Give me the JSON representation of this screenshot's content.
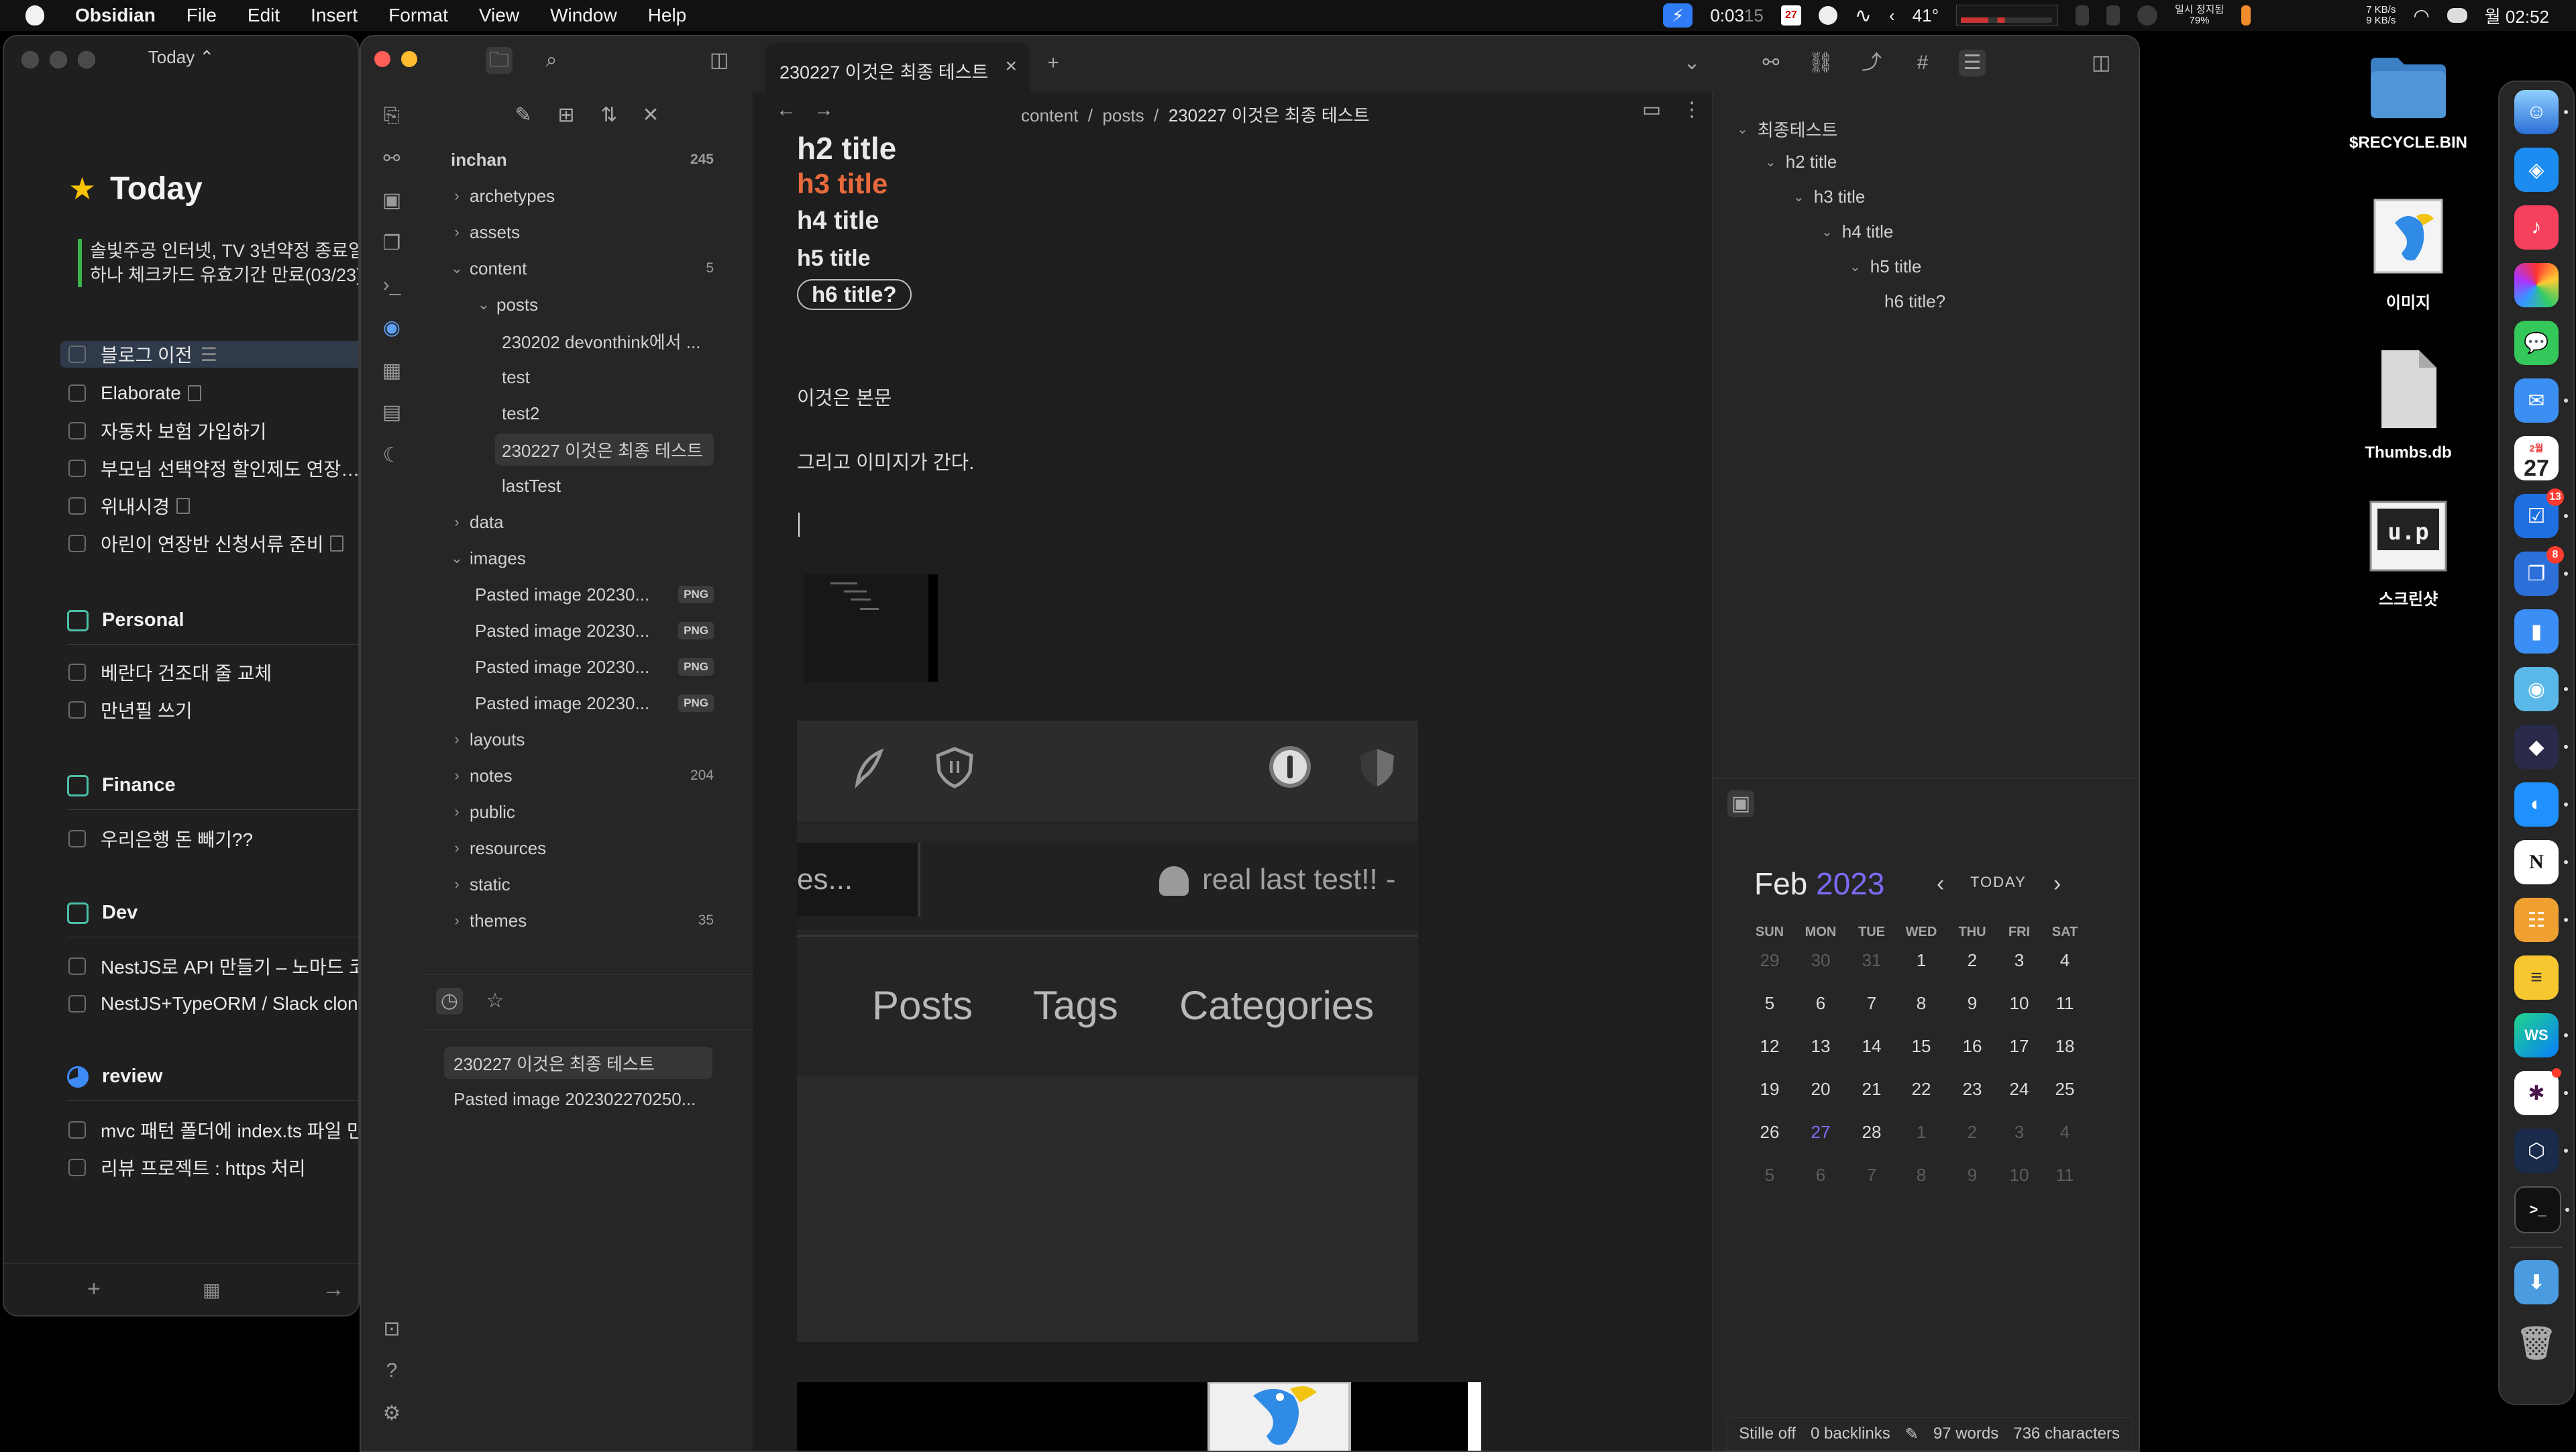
{
  "menubar": {
    "app": "Obsidian",
    "menus": [
      "File",
      "Edit",
      "Insert",
      "Format",
      "View",
      "Window",
      "Help"
    ],
    "timer": "0:03",
    "timer_seconds": "15",
    "calendar_day": "27",
    "temperature": "41°",
    "pause_label": "일시 정지됨",
    "battery_pct": "79%",
    "net_up": "7 KB/s",
    "net_down": "9 KB/s",
    "clock": "월 02:52"
  },
  "today": {
    "title": "Today",
    "heading": "Today",
    "notices": [
      "솔빛주공 인터넷, TV 3년약정 종료일",
      "하나 체크카드 유효기간 만료(03/23)"
    ],
    "tasks": [
      "블로그 이전",
      "Elaborate",
      "자동차 보험 가입하기",
      "부모님 선택약정 할인제도 연장…",
      "위내시경",
      "아린이 연장반 신청서류 준비"
    ],
    "areas": [
      {
        "name": "Personal",
        "tasks": [
          "베란다 건조대 줄 교체",
          "만년필 쓰기"
        ]
      },
      {
        "name": "Finance",
        "tasks": [
          "우리은행 돈 빼기??"
        ]
      },
      {
        "name": "Dev",
        "tasks": [
          "NestJS로 API 만들기 – 노마드 코더",
          "NestJS+TypeORM / Slack clone"
        ]
      },
      {
        "name": "review",
        "tasks": [
          "mvc 패턴 폴더에 index.ts 파일 만들기",
          "리뷰 프로젝트 : https 처리"
        ]
      }
    ]
  },
  "obsidian": {
    "tab_title": "230227 이것은 최종 테스트",
    "vault": {
      "name": "inchan",
      "count": "245"
    },
    "tree": [
      {
        "label": "archetypes",
        "depth": 0,
        "open": false
      },
      {
        "label": "assets",
        "depth": 0,
        "open": false
      },
      {
        "label": "content",
        "depth": 0,
        "open": true,
        "count": "5"
      },
      {
        "label": "posts",
        "depth": 1,
        "open": true
      },
      {
        "label": "230202 devonthink에서 ...",
        "depth": 2
      },
      {
        "label": "test",
        "depth": 2
      },
      {
        "label": "test2",
        "depth": 2
      },
      {
        "label": "230227 이것은 최종 테스트",
        "depth": 2,
        "selected": true
      },
      {
        "label": "lastTest",
        "depth": 2
      },
      {
        "label": "data",
        "depth": 0,
        "open": false
      },
      {
        "label": "images",
        "depth": 0,
        "open": true
      },
      {
        "label": "Pasted image 20230...",
        "depth": 1,
        "badge": "PNG"
      },
      {
        "label": "Pasted image 20230...",
        "depth": 1,
        "badge": "PNG"
      },
      {
        "label": "Pasted image 20230...",
        "depth": 1,
        "badge": "PNG"
      },
      {
        "label": "Pasted image 20230...",
        "depth": 1,
        "badge": "PNG"
      },
      {
        "label": "layouts",
        "depth": 0,
        "open": false
      },
      {
        "label": "notes",
        "depth": 0,
        "open": false,
        "count": "204"
      },
      {
        "label": "public",
        "depth": 0,
        "open": false
      },
      {
        "label": "resources",
        "depth": 0,
        "open": false
      },
      {
        "label": "static",
        "depth": 0,
        "open": false
      },
      {
        "label": "themes",
        "depth": 0,
        "open": false,
        "count": "35"
      }
    ],
    "recent": [
      "230227 이것은 최종 테스트",
      "Pasted image 202302270250..."
    ],
    "breadcrumb": [
      "content",
      "posts",
      "230227 이것은 최종 테스트"
    ],
    "doc": {
      "h2": "h2  title",
      "h3": "h3 title",
      "h4": "h4 title",
      "h5": "h5 title",
      "h6": "h6 title?",
      "p1": "이것은 본문",
      "p2": "그리고 이미지가 간다."
    },
    "embedded": {
      "search_text": "es...",
      "post_title": "real last test!! -",
      "nav": [
        "Posts",
        "Tags",
        "Categories"
      ]
    },
    "outline": [
      {
        "label": "최종테스트",
        "level": 0
      },
      {
        "label": "h2 title",
        "level": 1
      },
      {
        "label": "h3 title",
        "level": 2
      },
      {
        "label": "h4 title",
        "level": 3
      },
      {
        "label": "h5 title",
        "level": 4
      },
      {
        "label": "h6 title?",
        "level": 5
      }
    ],
    "calendar": {
      "month": "Feb",
      "year": "2023",
      "today_label": "TODAY",
      "weekdays": [
        "SUN",
        "MON",
        "TUE",
        "WED",
        "THU",
        "FRI",
        "SAT"
      ],
      "weeks": [
        [
          "29",
          "30",
          "31",
          "1",
          "2",
          "3",
          "4"
        ],
        [
          "5",
          "6",
          "7",
          "8",
          "9",
          "10",
          "11"
        ],
        [
          "12",
          "13",
          "14",
          "15",
          "16",
          "17",
          "18"
        ],
        [
          "19",
          "20",
          "21",
          "22",
          "23",
          "24",
          "25"
        ],
        [
          "26",
          "27",
          "28",
          "1",
          "2",
          "3",
          "4"
        ],
        [
          "5",
          "6",
          "7",
          "8",
          "9",
          "10",
          "11"
        ]
      ],
      "today": "27"
    },
    "status": {
      "plugin": "Stille off",
      "backlinks": "0 backlinks",
      "words": "97 words",
      "chars": "736 characters"
    }
  },
  "desktop": [
    {
      "label": "$RECYCLE.BIN",
      "icon": "folder-icon"
    },
    {
      "label": "이미지",
      "icon": "preview-icon"
    },
    {
      "label": "Thumbs.db",
      "icon": "document-icon"
    },
    {
      "label": "스크린샷",
      "icon": "screenshot-icon"
    }
  ],
  "dock": {
    "badges": {
      "todo": "13",
      "copyclip": "8"
    },
    "calendar_month": "2월",
    "calendar_day": "27"
  }
}
